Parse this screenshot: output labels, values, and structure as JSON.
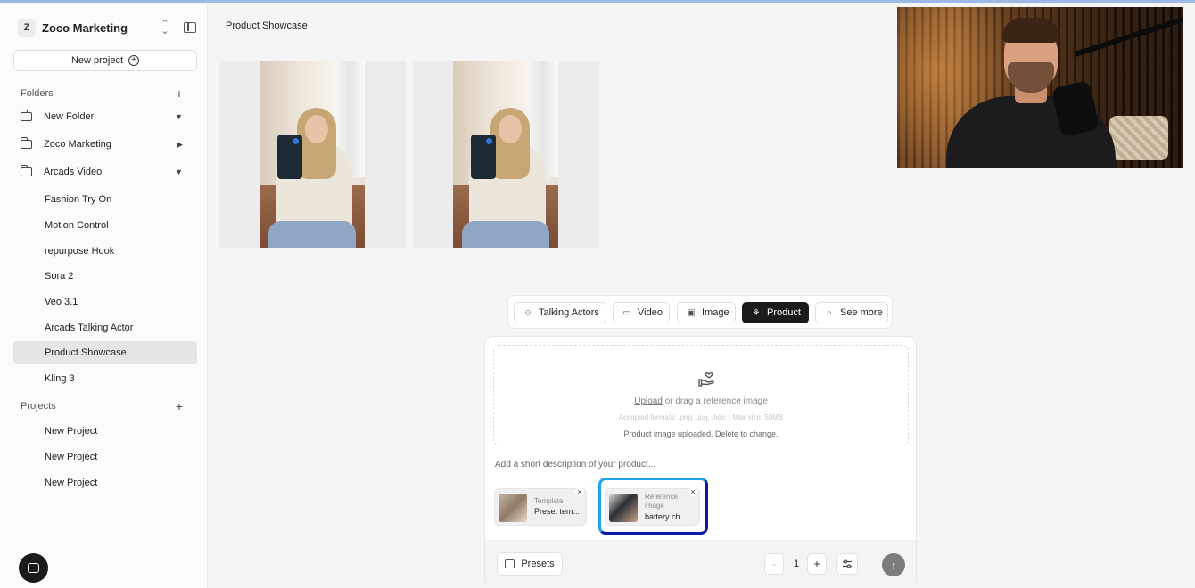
{
  "workspace": {
    "badge": "Z",
    "name": "Zoco Marketing",
    "switch_icon": "chevron-up-down-icon",
    "panel_icon": "sidebar-toggle-icon"
  },
  "sidebar": {
    "new_project_label": "New project",
    "folders_label": "Folders",
    "folders": [
      {
        "label": "New Folder",
        "caret": "▼"
      },
      {
        "label": "Zoco Marketing",
        "caret": "▶"
      },
      {
        "label": "Arcads Video",
        "caret": "▼"
      }
    ],
    "subitems": [
      "Fashion Try On",
      "Motion Control",
      "repurpose Hook",
      "Sora 2",
      "Veo 3.1",
      "Arcads Talking Actor",
      "Product Showcase",
      "Kling 3"
    ],
    "active_subitem": "Product Showcase",
    "projects_label": "Projects",
    "projects": [
      "New Project",
      "New Project",
      "New Project"
    ]
  },
  "main": {
    "title": "Product Showcase"
  },
  "modes": [
    {
      "label": "Talking Actors",
      "icon": "smile-icon",
      "active": false
    },
    {
      "label": "Video",
      "icon": "clapperboard-icon",
      "active": false
    },
    {
      "label": "Image",
      "icon": "image-icon",
      "active": false
    },
    {
      "label": "Product",
      "icon": "product-hand-icon",
      "active": true
    },
    {
      "label": "See more",
      "icon": "search-icon",
      "active": false
    }
  ],
  "composer": {
    "upload_link": "Upload",
    "upload_text": " or drag a reference image",
    "accepted": "Accepted formats: .png, .jpg, .heic | Max size: 50MB",
    "status": "Product image uploaded. Delete to change.",
    "description_placeholder": "Add a short description of your product...",
    "chips": [
      {
        "kind": "Template",
        "value": "Preset tem..."
      },
      {
        "kind": "Reference image",
        "value": "battery ch..."
      }
    ],
    "presets_label": "Presets",
    "minus": "-",
    "count": "1",
    "plus": "+",
    "send_icon": "arrow-up-icon",
    "accent_colors": {
      "ref_frame_light": "#1ba4e6",
      "ref_frame_dark": "#0b1aa8"
    }
  }
}
